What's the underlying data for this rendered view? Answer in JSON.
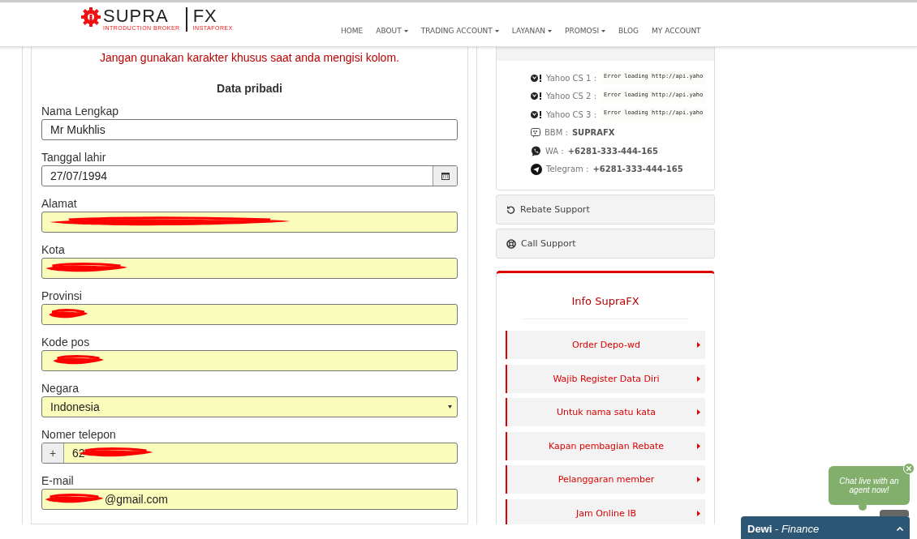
{
  "header": {
    "logo": {
      "brand": "SUPRA",
      "suffix": "FX",
      "tagline": "INTRODUCTION BROKER",
      "partner": "INSTAFOREX"
    },
    "nav": [
      {
        "label": "HOME",
        "dropdown": false
      },
      {
        "label": "ABOUT",
        "dropdown": true
      },
      {
        "label": "TRADING ACCOUNT",
        "dropdown": true
      },
      {
        "label": "LAYANAN",
        "dropdown": true
      },
      {
        "label": "PROMOSI",
        "dropdown": true
      },
      {
        "label": "BLOG",
        "dropdown": false
      },
      {
        "label": "MY ACCOUNT",
        "dropdown": false
      }
    ]
  },
  "form": {
    "notice": "Jangan gunakan karakter khusus saat anda mengisi kolom.",
    "section_title": "Data pribadi",
    "fields": [
      {
        "label": "Nama Lengkap",
        "kind": "text",
        "value": "Mr Mukhlis",
        "autofilled": false,
        "redacted": false
      },
      {
        "label": "Tanggal lahir",
        "kind": "date",
        "value": "27/07/1994",
        "autofilled": false,
        "redacted": false
      },
      {
        "label": "Alamat",
        "kind": "text",
        "autofilled": true,
        "redacted": true
      },
      {
        "label": "Kota",
        "kind": "text",
        "autofilled": true,
        "redacted": true
      },
      {
        "label": "Provinsi",
        "kind": "text",
        "autofilled": true,
        "redacted": true
      },
      {
        "label": "Kode pos",
        "kind": "text",
        "autofilled": true,
        "redacted": true
      },
      {
        "label": "Negara",
        "kind": "select",
        "value": "Indonesia",
        "autofilled": true,
        "redacted": false
      },
      {
        "label": "Nomer telepon",
        "kind": "phone",
        "addon": "+",
        "value": "62",
        "autofilled": true,
        "redacted": true
      },
      {
        "label": "E-mail",
        "kind": "text",
        "value": "@gmail.com",
        "autofilled": true,
        "redacted": true
      }
    ]
  },
  "support": {
    "contacts": [
      {
        "kind": "yahoo",
        "label": "Yahoo CS 1 :",
        "status": "Error loading http://api.yaho"
      },
      {
        "kind": "yahoo",
        "label": "Yahoo CS 2 :",
        "status": "Error loading http://api.yaho"
      },
      {
        "kind": "yahoo",
        "label": "Yahoo CS 3 :",
        "status": "Error loading http://api.yaho"
      },
      {
        "kind": "bbm",
        "label": "BBM :",
        "value": "SUPRAFX"
      },
      {
        "kind": "whatsapp",
        "label": "WA :",
        "value": "+6281-333-444-165"
      },
      {
        "kind": "telegram",
        "label": "Telegram :",
        "value": "+6281-333-444-165"
      }
    ],
    "buttons": [
      {
        "kind": "rebate",
        "label": "Rebate Support"
      },
      {
        "kind": "call",
        "label": "Call Support"
      }
    ]
  },
  "info": {
    "title": "Info SupraFX",
    "items": [
      "Order Depo-wd",
      "Wajib Register Data Diri",
      "Untuk nama satu kata",
      "Kapan pembagian Rebate",
      "Pelanggaran member",
      "Jam Online IB"
    ]
  },
  "chat": {
    "bubble": "Chat live with an agent now!",
    "agent": "**Dewi** - *Finance*"
  }
}
